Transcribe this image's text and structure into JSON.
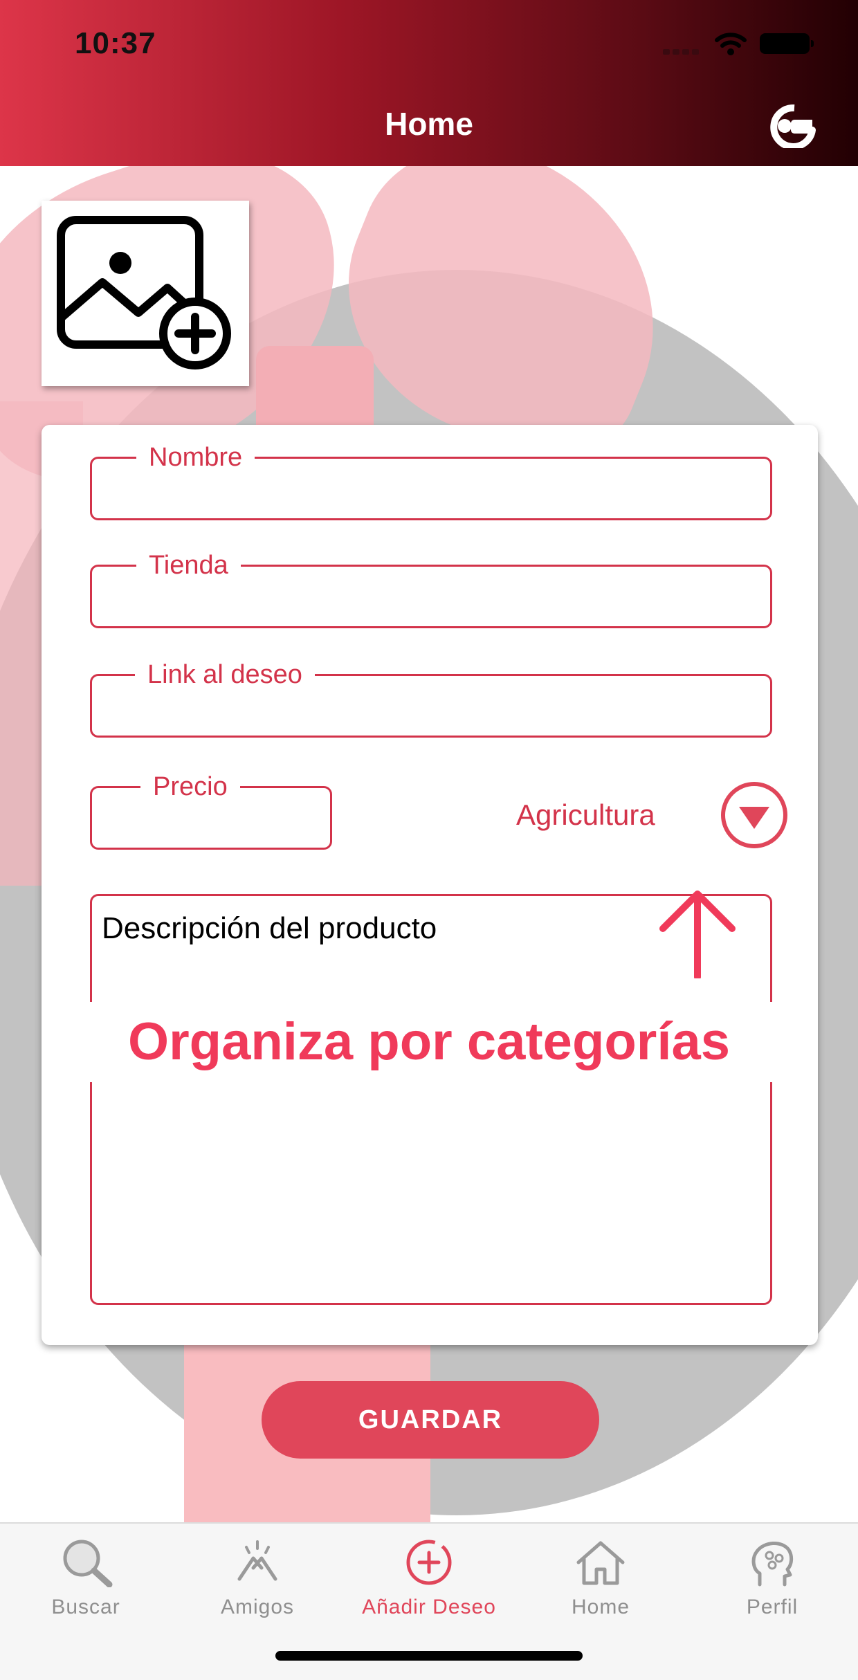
{
  "status_bar": {
    "time": "10:37"
  },
  "header": {
    "title": "Home"
  },
  "form": {
    "fields": {
      "nombre": {
        "label": "Nombre",
        "value": ""
      },
      "tienda": {
        "label": "Tienda",
        "value": ""
      },
      "link": {
        "label": "Link al deseo",
        "value": ""
      },
      "precio": {
        "label": "Precio",
        "value": ""
      }
    },
    "category": "Agricultura",
    "description_placeholder": "Descripción del producto"
  },
  "overlay_caption": "Organiza por categorías",
  "save_label": "GUARDAR",
  "tabs": [
    {
      "label": "Buscar",
      "icon": "search-icon"
    },
    {
      "label": "Amigos",
      "icon": "friends-icon"
    },
    {
      "label": "Añadir Deseo",
      "icon": "add-circle-icon",
      "active": true
    },
    {
      "label": "Home",
      "icon": "home-icon"
    },
    {
      "label": "Perfil",
      "icon": "profile-icon"
    }
  ],
  "colors": {
    "accent": "#d3334a",
    "button": "#e0465a",
    "caption": "#f03a5a",
    "header_start": "#dd3549",
    "header_end": "#220003"
  }
}
